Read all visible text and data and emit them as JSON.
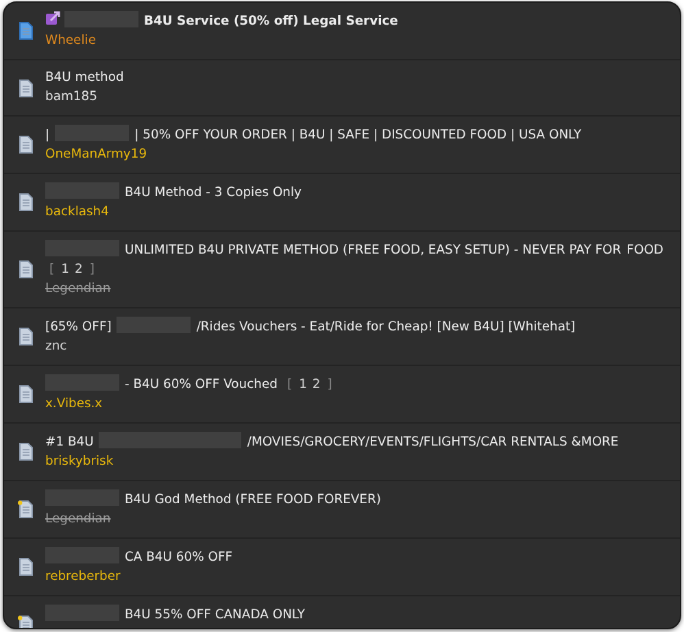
{
  "threads": [
    {
      "unread": true,
      "posted": false,
      "moved": true,
      "bold": true,
      "author": {
        "name": "Wheelie",
        "color": "#e08a1e",
        "banned": false
      },
      "title_parts": [
        {
          "kind": "redacted"
        },
        {
          "kind": "text",
          "text": "B4U Service (50% off) Legal Service"
        }
      ]
    },
    {
      "unread": false,
      "posted": false,
      "moved": false,
      "bold": false,
      "author": {
        "name": "bam185",
        "color": "#e0e0e0",
        "banned": false
      },
      "title_parts": [
        {
          "kind": "text",
          "text": "B4U method"
        }
      ]
    },
    {
      "unread": false,
      "posted": false,
      "moved": false,
      "bold": false,
      "author": {
        "name": "OneManArmy19",
        "color": "#e8b80c",
        "banned": false
      },
      "title_parts": [
        {
          "kind": "text",
          "text": "|"
        },
        {
          "kind": "redacted"
        },
        {
          "kind": "text",
          "text": "| 50% OFF YOUR ORDER | B4U | SAFE | DISCOUNTED FOOD | USA ONLY"
        }
      ]
    },
    {
      "unread": false,
      "posted": false,
      "moved": false,
      "bold": false,
      "author": {
        "name": "backlash4",
        "color": "#e8b80c",
        "banned": false
      },
      "title_parts": [
        {
          "kind": "redacted"
        },
        {
          "kind": "text",
          "text": "B4U Method - 3 Copies Only"
        }
      ]
    },
    {
      "unread": false,
      "posted": false,
      "moved": false,
      "bold": false,
      "author": {
        "name": "Legendian",
        "color": "#9a9a9a",
        "banned": true
      },
      "title_parts": [
        {
          "kind": "redacted"
        },
        {
          "kind": "text",
          "text": "UNLIMITED B4U PRIVATE METHOD (FREE FOOD, EASY SETUP) - NEVER PAY FOR"
        },
        {
          "kind": "text",
          "text": "FOOD"
        },
        {
          "kind": "bracket",
          "text": "["
        },
        {
          "kind": "page",
          "text": "1"
        },
        {
          "kind": "page",
          "text": "2"
        },
        {
          "kind": "bracket",
          "text": "]"
        }
      ]
    },
    {
      "unread": false,
      "posted": false,
      "moved": false,
      "bold": false,
      "author": {
        "name": "znc",
        "color": "#d8d8d8",
        "banned": false
      },
      "title_parts": [
        {
          "kind": "text",
          "text": "[65% OFF]"
        },
        {
          "kind": "redacted"
        },
        {
          "kind": "text",
          "text": "/Rides Vouchers - Eat/Ride for Cheap! [New B4U] [Whitehat]"
        }
      ]
    },
    {
      "unread": false,
      "posted": false,
      "moved": false,
      "bold": false,
      "author": {
        "name": "x.Vibes.x",
        "color": "#e8b80c",
        "banned": false
      },
      "title_parts": [
        {
          "kind": "redacted"
        },
        {
          "kind": "text",
          "text": "- B4U 60% OFF Vouched"
        },
        {
          "kind": "bracket",
          "text": "["
        },
        {
          "kind": "page",
          "text": "1"
        },
        {
          "kind": "page",
          "text": "2"
        },
        {
          "kind": "bracket",
          "text": "]"
        }
      ]
    },
    {
      "unread": false,
      "posted": false,
      "moved": false,
      "bold": false,
      "author": {
        "name": "briskybrisk",
        "color": "#e8b80c",
        "banned": false
      },
      "title_parts": [
        {
          "kind": "text",
          "text": "#1 B4U"
        },
        {
          "kind": "redacted_wide"
        },
        {
          "kind": "text",
          "text": "/MOVIES/GROCERY/EVENTS/FLIGHTS/CAR RENTALS &MORE"
        }
      ]
    },
    {
      "unread": false,
      "posted": true,
      "moved": false,
      "bold": false,
      "author": {
        "name": "Legendian",
        "color": "#9a9a9a",
        "banned": true
      },
      "title_parts": [
        {
          "kind": "redacted"
        },
        {
          "kind": "text",
          "text": "B4U God Method (FREE FOOD FOREVER)"
        }
      ]
    },
    {
      "unread": false,
      "posted": false,
      "moved": false,
      "bold": false,
      "author": {
        "name": "rebreberber",
        "color": "#e8b80c",
        "banned": false
      },
      "title_parts": [
        {
          "kind": "redacted"
        },
        {
          "kind": "text",
          "text": "CA B4U 60% OFF"
        }
      ]
    },
    {
      "unread": false,
      "posted": true,
      "moved": false,
      "bold": false,
      "title_parts": [
        {
          "kind": "redacted"
        },
        {
          "kind": "text",
          "text": "B4U 55% OFF CANADA ONLY"
        }
      ]
    }
  ]
}
